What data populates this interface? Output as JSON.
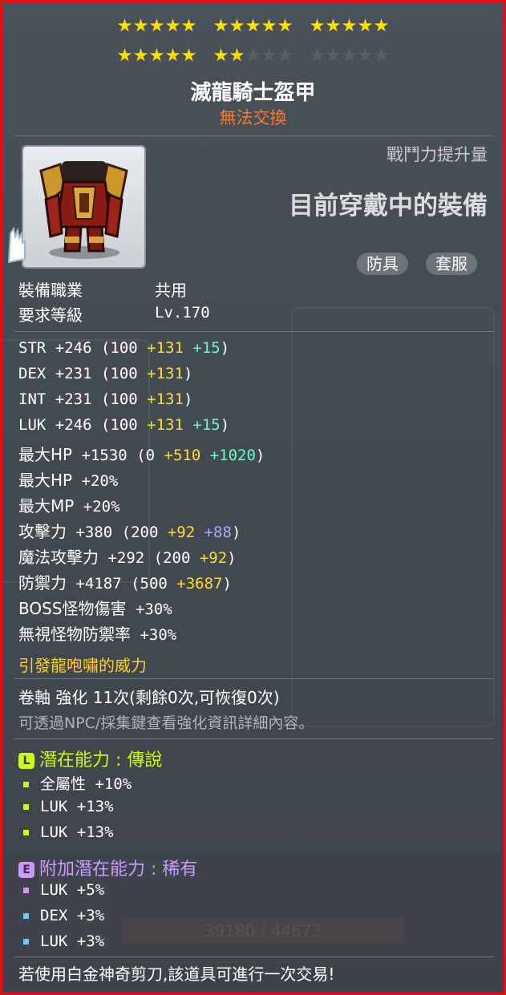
{
  "stars": {
    "row1": [
      [
        1,
        1,
        1,
        1,
        1
      ],
      [
        1,
        1,
        1,
        1,
        1
      ],
      [
        1,
        1,
        1,
        1,
        1
      ]
    ],
    "row2": [
      [
        1,
        1,
        1,
        1,
        1
      ],
      [
        1,
        1,
        0,
        0,
        0
      ],
      [
        0,
        0,
        0,
        0,
        0
      ]
    ]
  },
  "item": {
    "name": "滅龍騎士盔甲",
    "trade_status": "無法交換",
    "icon": "dragon-knight-armor-icon",
    "power_label": "戰鬥力提升量",
    "equipped_label": "目前穿戴中的裝備",
    "tags": [
      "防具",
      "套服"
    ]
  },
  "requirements": [
    {
      "label": "裝備職業",
      "value": "共用"
    },
    {
      "label": "要求等級",
      "value": "Lv.170"
    }
  ],
  "stats": [
    {
      "name": "STR",
      "total": "+246",
      "base": "(100",
      "parts": [
        {
          "text": "+131",
          "color": "yellow"
        },
        {
          "text": "+15",
          "color": "green"
        }
      ]
    },
    {
      "name": "DEX",
      "total": "+231",
      "base": "(100",
      "parts": [
        {
          "text": "+131",
          "color": "yellow"
        }
      ]
    },
    {
      "name": "INT",
      "total": "+231",
      "base": "(100",
      "parts": [
        {
          "text": "+131",
          "color": "yellow"
        }
      ]
    },
    {
      "name": "LUK",
      "total": "+246",
      "base": "(100",
      "parts": [
        {
          "text": "+131",
          "color": "yellow"
        },
        {
          "text": "+15",
          "color": "green"
        }
      ]
    },
    {
      "name": "最大HP",
      "total": "+1530",
      "base": "(0",
      "parts": [
        {
          "text": "+510",
          "color": "yellow"
        },
        {
          "text": "+1020",
          "color": "green"
        }
      ]
    },
    {
      "name": "最大HP",
      "total": "+20%",
      "base": "",
      "parts": []
    },
    {
      "name": "最大MP",
      "total": "+20%",
      "base": "",
      "parts": []
    },
    {
      "name": "攻擊力",
      "total": "+380",
      "base": "(200",
      "parts": [
        {
          "text": "+92",
          "color": "yellow"
        },
        {
          "text": "+88",
          "color": "purple"
        }
      ]
    },
    {
      "name": "魔法攻擊力",
      "total": "+292",
      "base": "(200",
      "parts": [
        {
          "text": "+92",
          "color": "yellow"
        }
      ]
    },
    {
      "name": "防禦力",
      "total": "+4187",
      "base": "(500",
      "parts": [
        {
          "text": "+3687",
          "color": "yellow"
        }
      ]
    },
    {
      "name": "BOSS怪物傷害",
      "total": "+30%",
      "base": "",
      "parts": []
    },
    {
      "name": "無視怪物防禦率",
      "total": "+30%",
      "base": "",
      "parts": []
    }
  ],
  "special": "引發龍咆嘯的威力",
  "scroll": "卷軸 強化 11次(剩餘0次,可恢復0次)",
  "scroll_note": "可透過NPC/採集鍵查看強化資訊詳細內容。",
  "potential": {
    "badge": "L",
    "title": "潛在能力 : 傳說",
    "color": "#ccff00",
    "lines": [
      "全屬性 +10%",
      "LUK +13%",
      "LUK +13%"
    ]
  },
  "bonus_potential": {
    "badge": "E",
    "title": "附加潛在能力 : 稀有",
    "color": "#cc99ff",
    "lines": [
      "LUK +5%",
      "DEX +3%",
      "LUK +3%"
    ],
    "bullet_colors": [
      "#cc99ff",
      "#66ccff",
      "#66ccff"
    ]
  },
  "footer": "若使用白金神奇剪刀,該道具可進行一次交易!",
  "background_bar": "39180 / 44673"
}
